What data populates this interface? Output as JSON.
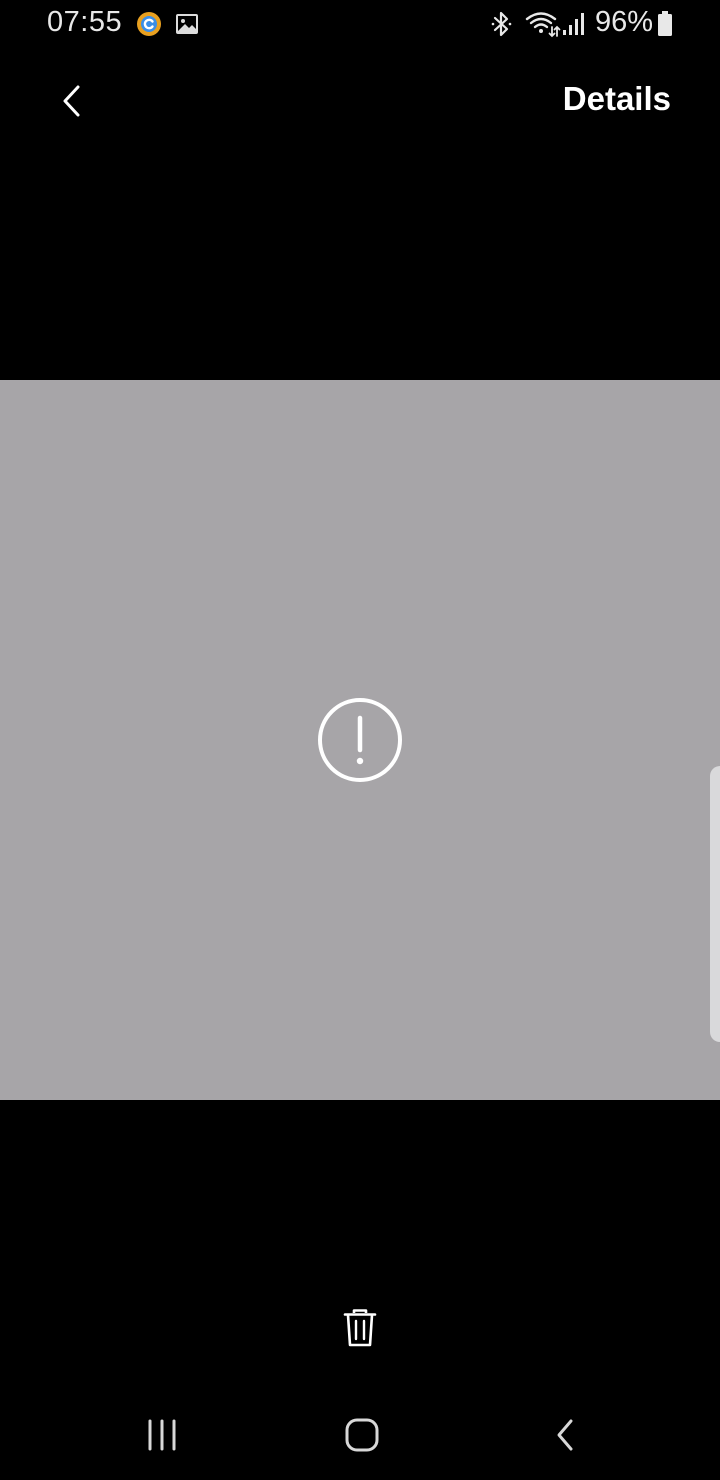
{
  "status_bar": {
    "time": "07:55",
    "battery_percent": "96%",
    "notification_icons": [
      "app-icon",
      "gallery-icon"
    ],
    "system_icons": [
      "bluetooth-icon",
      "wifi-icon",
      "signal-icon",
      "battery-icon"
    ],
    "app_icon_colors": {
      "ring": "#e8a020",
      "inner": "#3a8ee8"
    }
  },
  "app_bar": {
    "back_icon": "chevron-left-icon",
    "details_label": "Details"
  },
  "media": {
    "background_color": "#a7a5a8",
    "state_icon": "error-circle-icon"
  },
  "toolbar": {
    "delete_icon": "trash-icon"
  },
  "nav_bar": {
    "recents_icon": "recents-icon",
    "home_icon": "home-icon",
    "back_icon": "back-icon"
  }
}
